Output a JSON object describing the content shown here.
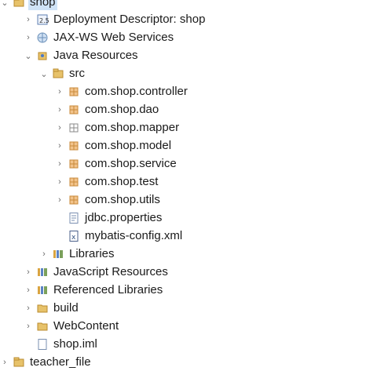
{
  "tree": {
    "project_shop": "shop",
    "deployment_descriptor": "Deployment Descriptor: shop",
    "jax_ws": "JAX-WS Web Services",
    "java_resources": "Java Resources",
    "src": "src",
    "packages": [
      "com.shop.controller",
      "com.shop.dao",
      "com.shop.mapper",
      "com.shop.model",
      "com.shop.service",
      "com.shop.test",
      "com.shop.utils"
    ],
    "jdbc_properties": "jdbc.properties",
    "mybatis_config": "mybatis-config.xml",
    "libraries": "Libraries",
    "javascript_resources": "JavaScript Resources",
    "referenced_libraries": "Referenced Libraries",
    "build": "build",
    "webcontent": "WebContent",
    "shop_iml": "shop.iml",
    "project_teacher_file": "teacher_file"
  },
  "colors": {
    "package": "#c88a3a",
    "folder": "#e7c26a",
    "selection": "#cfe3f7"
  }
}
